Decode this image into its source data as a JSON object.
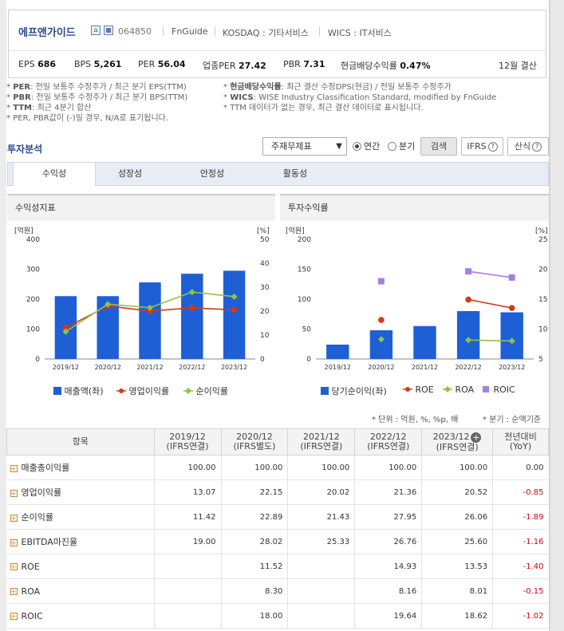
{
  "company": {
    "name": "에프앤가이드",
    "code": "064850",
    "source": "FnGuide",
    "market": "KOSDAQ : 기타서비스",
    "wics": "WICS : IT서비스",
    "icon_home": "home-icon",
    "icon_building": "building-icon"
  },
  "stats": [
    {
      "label": "EPS",
      "value": "686"
    },
    {
      "label": "BPS",
      "value": "5,261"
    },
    {
      "label": "PER",
      "value": "56.04"
    },
    {
      "label": "업종PER",
      "value": "27.42"
    },
    {
      "label": "PBR",
      "value": "7.31"
    },
    {
      "label": "현금배당수익률",
      "value": "0.47%"
    }
  ],
  "settlement": "12월 결산",
  "notes_left": [
    {
      "key": "PER",
      "text": ": 전일 보통주 수정주가 / 최근 분기 EPS(TTM)"
    },
    {
      "key": "PBR",
      "text": ": 전일 보통주 수정주가 / 최근 분기 BPS(TTM)"
    },
    {
      "key": "TTM",
      "text": ": 최근 4분기 합산"
    },
    {
      "key": "",
      "text": "PER, PBR값이 (-)일 경우, N/A로 표기됩니다."
    }
  ],
  "notes_right": [
    {
      "key": "현금배당수익률",
      "text": ": 최근 결산 수정DPS(현금) / 전일 보통주 수정주가"
    },
    {
      "key": "WICS",
      "text": ": WISE Industry Classification Standard, modified by FnGuide"
    },
    {
      "key": "",
      "text": "TTM 데이터가 없는 경우, 최근 결산 데이터로 표시됩니다."
    }
  ],
  "section_title": "투자분석",
  "controls": {
    "select_value": "주재무제표",
    "radio_annual": "연간",
    "radio_quarter": "분기",
    "search_button": "검색",
    "ifrs_button": "IFRS",
    "sanshik_button": "산식"
  },
  "tabs": [
    "수익성",
    "성장성",
    "안정성",
    "활동성"
  ],
  "panels": {
    "left_title": "수익성지표",
    "right_title": "투자수익률"
  },
  "colors": {
    "bar": "#1f5fd6",
    "red": "#d13a1b",
    "green": "#8dc63f",
    "purple": "#a77fe0"
  },
  "chart_data": [
    {
      "type": "bar+line",
      "title": "수익성지표",
      "left_unit": "[억원]",
      "right_unit": "[%]",
      "categories": [
        "2019/12",
        "2020/12",
        "2021/12",
        "2022/12",
        "2023/12"
      ],
      "ylim_left": [
        0,
        400
      ],
      "yticks_left": [
        "0",
        "100",
        "200",
        "300",
        "400"
      ],
      "ylim_right": [
        0,
        50
      ],
      "yticks_right": [
        "0",
        "10",
        "20",
        "30",
        "40",
        "50"
      ],
      "series": [
        {
          "name": "매출액(좌)",
          "kind": "bar",
          "axis": "left",
          "values": [
            210,
            210,
            256,
            285,
            295
          ]
        },
        {
          "name": "영업이익률",
          "kind": "line",
          "axis": "right",
          "color": "red",
          "values": [
            13.07,
            22.15,
            20.02,
            21.36,
            20.52
          ]
        },
        {
          "name": "순이익률",
          "kind": "line",
          "axis": "right",
          "color": "green",
          "values": [
            11.42,
            22.89,
            21.43,
            27.95,
            26.06
          ]
        }
      ]
    },
    {
      "type": "bar+line",
      "title": "투자수익률",
      "left_unit": "[억원]",
      "right_unit": "[%]",
      "categories": [
        "2019/12",
        "2020/12",
        "2021/12",
        "2022/12",
        "2023/12"
      ],
      "ylim_left": [
        0,
        200
      ],
      "yticks_left": [
        "0",
        "50",
        "100",
        "150",
        "200"
      ],
      "ylim_right": [
        5,
        25
      ],
      "yticks_right": [
        "5",
        "10",
        "15",
        "20",
        "25"
      ],
      "series": [
        {
          "name": "당기순이익(좌)",
          "kind": "bar",
          "axis": "left",
          "values": [
            24,
            48,
            55,
            80,
            78
          ]
        },
        {
          "name": "ROE",
          "kind": "line",
          "axis": "right",
          "color": "red",
          "values": [
            null,
            11.52,
            null,
            14.93,
            13.53
          ]
        },
        {
          "name": "ROA",
          "kind": "line",
          "axis": "right",
          "color": "green",
          "values": [
            null,
            8.3,
            null,
            8.16,
            8.01
          ]
        },
        {
          "name": "ROIC",
          "kind": "line",
          "axis": "right",
          "color": "purple",
          "values": [
            null,
            18.0,
            null,
            19.64,
            18.62
          ]
        }
      ]
    }
  ],
  "unit_note": "* 단위 : 억원, %, %p, 배",
  "quarter_note": "* 분기 : 순액기준",
  "table": {
    "header_item": "항목",
    "columns": [
      {
        "year": "2019/12",
        "basis": "(IFRS연결)"
      },
      {
        "year": "2020/12",
        "basis": "(IFRS별도)"
      },
      {
        "year": "2021/12",
        "basis": "(IFRS연결)"
      },
      {
        "year": "2022/12",
        "basis": "(IFRS연결)"
      },
      {
        "year": "2023/12",
        "basis": "(IFRS연결)"
      }
    ],
    "yoy_header": "전년대비",
    "yoy_sub": "(YoY)",
    "rows": [
      {
        "label": "매출총이익률",
        "values": [
          "100.00",
          "100.00",
          "100.00",
          "100.00",
          "100.00"
        ],
        "yoy": "0.00"
      },
      {
        "label": "영업이익률",
        "values": [
          "13.07",
          "22.15",
          "20.02",
          "21.36",
          "20.52"
        ],
        "yoy": "-0.85"
      },
      {
        "label": "순이익률",
        "values": [
          "11.42",
          "22.89",
          "21.43",
          "27.95",
          "26.06"
        ],
        "yoy": "-1.89"
      },
      {
        "label": "EBITDA마진율",
        "values": [
          "19.00",
          "28.02",
          "25.33",
          "26.76",
          "25.60"
        ],
        "yoy": "-1.16"
      },
      {
        "label": "ROE",
        "values": [
          "",
          "11.52",
          "",
          "14.93",
          "13.53"
        ],
        "yoy": "-1.40"
      },
      {
        "label": "ROA",
        "values": [
          "",
          "8.30",
          "",
          "8.16",
          "8.01"
        ],
        "yoy": "-0.15"
      },
      {
        "label": "ROIC",
        "values": [
          "",
          "18.00",
          "",
          "19.64",
          "18.62"
        ],
        "yoy": "-1.02"
      }
    ]
  }
}
